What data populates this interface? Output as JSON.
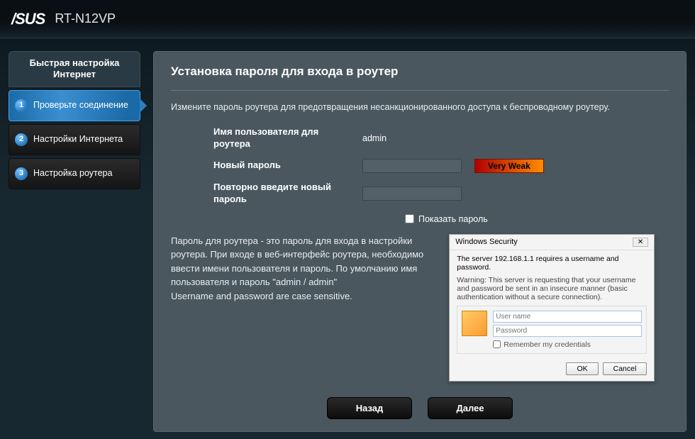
{
  "header": {
    "brand": "/SUS",
    "model": "RT-N12VP"
  },
  "sidebar": {
    "title": "Быстрая настройка Интернет",
    "items": [
      {
        "num": "1",
        "label": "Проверьте соединение"
      },
      {
        "num": "2",
        "label": "Настройки Интернета"
      },
      {
        "num": "3",
        "label": "Настройка роутера"
      }
    ]
  },
  "page": {
    "title": "Установка пароля для входа в роутер",
    "desc": "Измените пароль роутера для предотвращения несанкционированного доступа к беспроводному роутеру."
  },
  "form": {
    "username_label": "Имя пользователя для роутера",
    "username_value": "admin",
    "newpass_label": "Новый пароль",
    "newpass_value": "",
    "strength": "Very Weak",
    "retype_label": "Повторно введите новый пароль",
    "retype_value": "",
    "showpass_label": "Показать пароль"
  },
  "info": {
    "text_line1": "Пароль для роутера - это пароль для входа в настройки роутера. При входе в веб-интерфейс роутера, необходимо ввести имени пользователя и пароль. По умолчанию имя пользователя и пароль \"admin / admin\"",
    "text_line2": "Username and password are case sensitive."
  },
  "dialog": {
    "title": "Windows Security",
    "server_msg": "The server 192.168.1.1 requires a username and password.",
    "warning": "Warning: This server is requesting that your username and password be sent in an insecure manner (basic authentication without a secure connection).",
    "user_ph": "User name",
    "pass_ph": "Password",
    "remember": "Remember my credentials",
    "ok": "OK",
    "cancel": "Cancel"
  },
  "footer": {
    "back": "Назад",
    "next": "Далее"
  }
}
